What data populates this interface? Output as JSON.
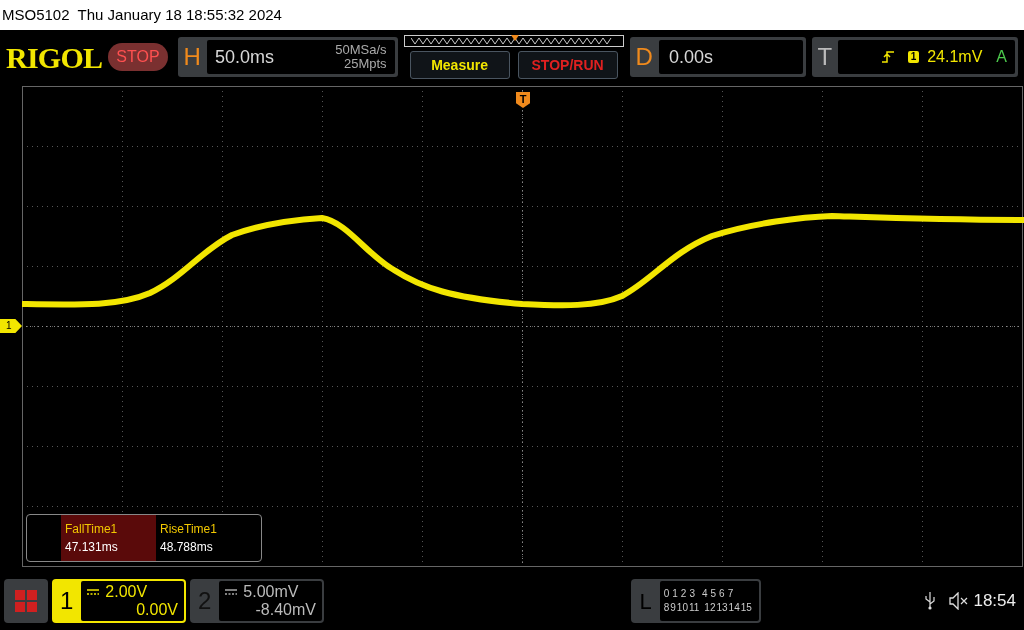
{
  "title_bar": {
    "text": "MSO5102  Thu January 18 18:55:32 2024"
  },
  "header": {
    "logo": "RIGOL",
    "run_state": {
      "label": "STOP",
      "kind": "stop"
    },
    "horizontal": {
      "label": "H",
      "timebase": "50.0ms",
      "sample_rate": "50MSa/s",
      "memory_depth": "25Mpts"
    },
    "buttons": [
      {
        "label": "Measure",
        "kind": "measure"
      },
      {
        "label": "STOP/RUN",
        "kind": "stoprun"
      }
    ],
    "delay": {
      "label": "D",
      "value": "0.00s"
    },
    "trigger": {
      "label": "T",
      "source": "1",
      "level": "24.1mV",
      "mode": "A"
    }
  },
  "screen": {
    "channel_marker": "1",
    "trigger_marker": "T"
  },
  "measurements": [
    {
      "name": "FallTime1",
      "value": "47.131ms",
      "selected": true
    },
    {
      "name": "RiseTime1",
      "value": "48.788ms",
      "selected": false
    }
  ],
  "channels": [
    {
      "number": "1",
      "scale": "2.00V",
      "offset": "0.00V",
      "active": true
    },
    {
      "number": "2",
      "scale": "5.00mV",
      "offset": "-8.40mV",
      "active": false
    }
  ],
  "logic": {
    "label": "L",
    "row_1": [
      "0",
      "1",
      "2",
      "3",
      "4",
      "5",
      "6",
      "7"
    ],
    "row_2": [
      "8",
      "9",
      "10",
      "11",
      "12",
      "13",
      "14",
      "15"
    ]
  },
  "status": {
    "time": "18:54"
  }
}
